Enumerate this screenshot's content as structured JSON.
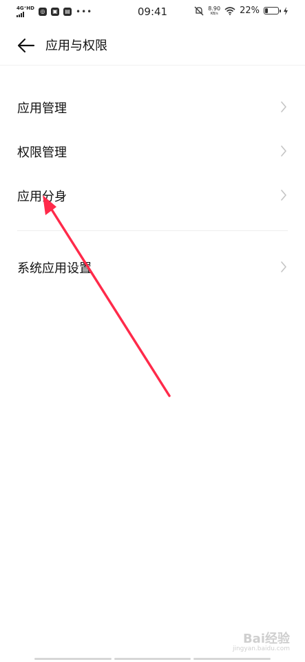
{
  "status_bar": {
    "network": "4G⁺HD",
    "time": "09:41",
    "speed_value": "8.90",
    "speed_unit": "KB/s",
    "battery_percent": "22%",
    "battery_level": 0.22
  },
  "header": {
    "title": "应用与权限"
  },
  "list": [
    {
      "label": "应用管理"
    },
    {
      "label": "权限管理"
    },
    {
      "label": "应用分身"
    },
    {
      "label": "系统应用设置"
    }
  ],
  "watermark": {
    "brand": "Bai经验",
    "url": "jingyan.baidu.com"
  },
  "colors": {
    "arrow": "#ff2a4a",
    "chevron": "#c4c4c4"
  }
}
